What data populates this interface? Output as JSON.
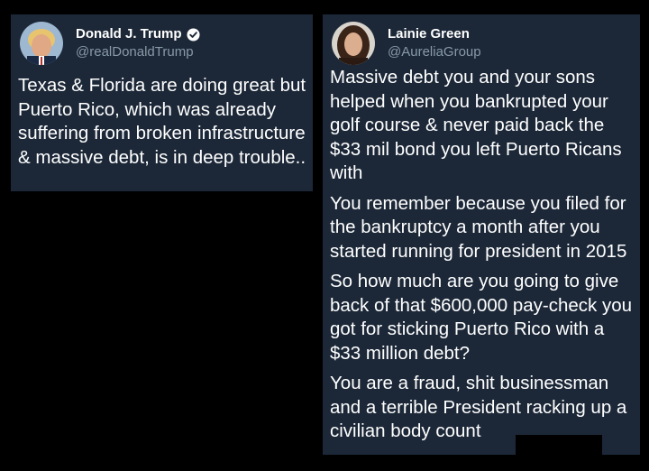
{
  "tweets": [
    {
      "display_name": "Donald J. Trump",
      "handle": "@realDonaldTrump",
      "verified": true,
      "text": "Texas & Florida are doing great but Puerto Rico, which was already suffering from broken infrastructure & massive debt, is in deep trouble.."
    },
    {
      "display_name": "Lainie Green",
      "handle": "@AureliaGroup",
      "verified": false,
      "paragraphs": [
        "Massive debt you and your sons helped when you bankrupted your golf course & never paid back the $33 mil bond you left Puerto Ricans with",
        "You remember because you filed for the bankruptcy a month after you started running for president in 2015",
        "So how much are you going to give back of that $600,000 pay-check you got for sticking Puerto Rico with a $33 million debt?",
        "You are a fraud, shit businessman and a terrible President racking up a civilian body count"
      ]
    }
  ],
  "colors": {
    "card_background": "#1c2838",
    "handle_text": "#8899a6",
    "verified_badge": "#ffffff"
  },
  "icons": {
    "verified": "verified-check-icon"
  }
}
